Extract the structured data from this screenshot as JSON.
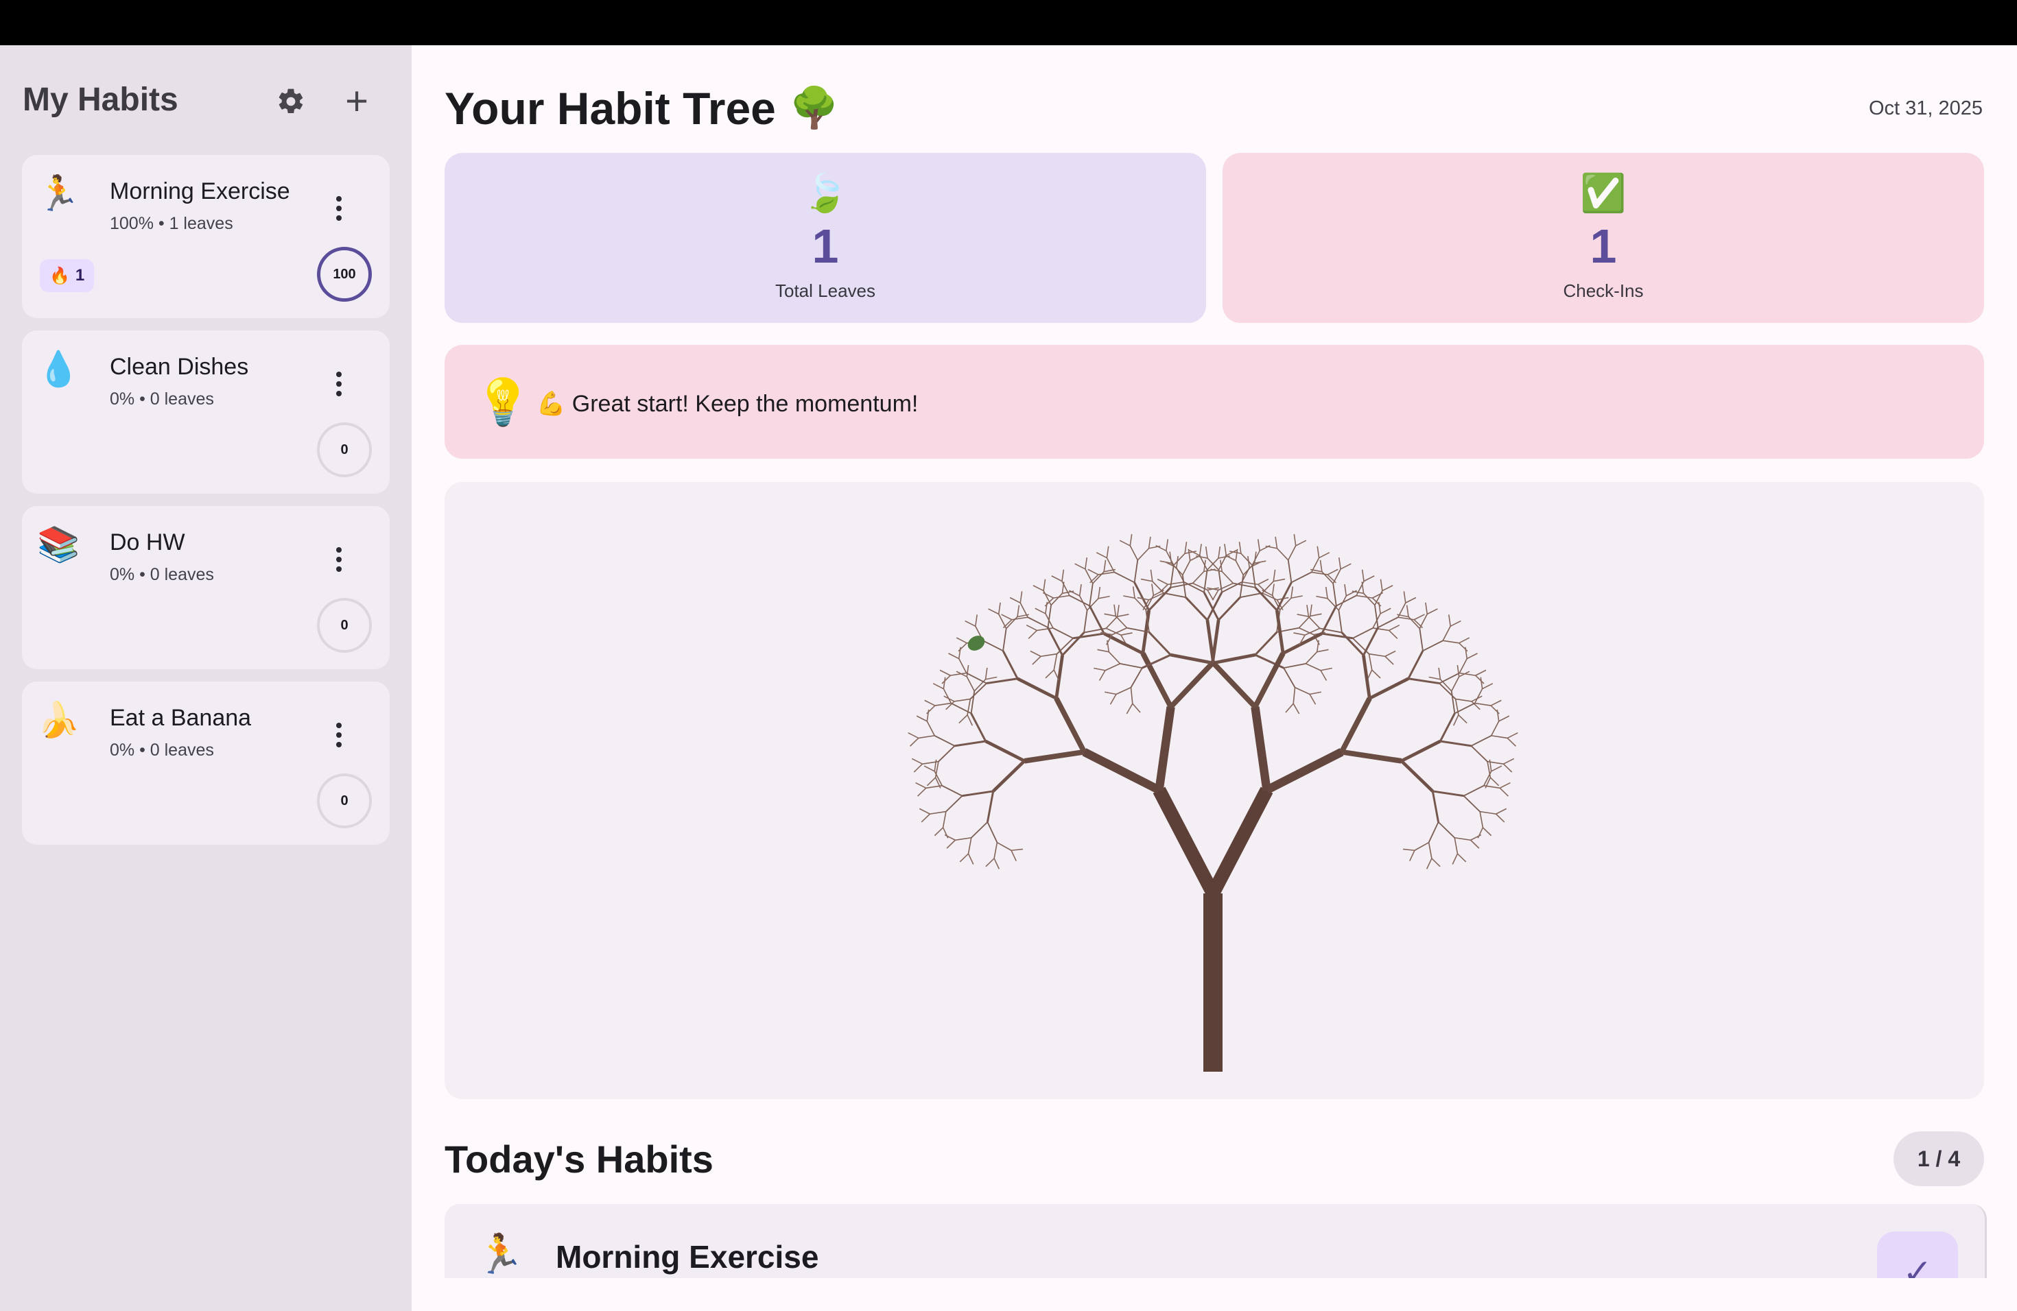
{
  "sidebar": {
    "title": "My Habits",
    "settings_icon": "gear-icon",
    "add_icon": "plus-icon",
    "habits": [
      {
        "emoji": "🏃",
        "name": "Morning Exercise",
        "meta": "100% • 1 leaves",
        "streak_icon": "🔥",
        "streak": "1",
        "progress": "100"
      },
      {
        "emoji": "💧",
        "name": "Clean Dishes",
        "meta": "0% • 0 leaves",
        "progress": "0"
      },
      {
        "emoji": "📚",
        "name": "Do HW",
        "meta": "0% • 0 leaves",
        "progress": "0"
      },
      {
        "emoji": "🍌",
        "name": "Eat a Banana",
        "meta": "0% • 0 leaves",
        "progress": "0"
      }
    ]
  },
  "main": {
    "title": "Your Habit Tree",
    "title_emoji": "🌳",
    "date": "Oct 31, 2025",
    "stats": [
      {
        "emoji": "🍃",
        "value": "1",
        "label": "Total Leaves"
      },
      {
        "emoji": "✅",
        "value": "1",
        "label": "Check-Ins"
      }
    ],
    "tip": {
      "emoji": "💡",
      "text": "💪 Great start! Keep the momentum!"
    },
    "tree": {
      "leaves": 1,
      "trunk_color": "#5d4037",
      "leaf_color": "#4f7d3f"
    },
    "today": {
      "title": "Today's Habits",
      "count": "1 / 4",
      "items": [
        {
          "emoji": "🏃",
          "name": "Morning Exercise",
          "check_icon": "✓"
        }
      ]
    }
  }
}
